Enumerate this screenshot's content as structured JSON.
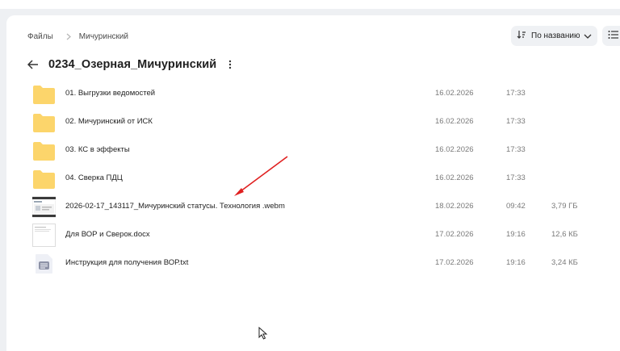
{
  "breadcrumb": {
    "root": "Файлы",
    "current": "Мичуринский"
  },
  "sort": {
    "label": "По названию"
  },
  "folder": {
    "title": "0234_Озерная_Мичуринский"
  },
  "files": [
    {
      "name": "01. Выгрузки ведомостей",
      "date": "16.02.2026",
      "time": "17:33",
      "size": "",
      "type": "folder"
    },
    {
      "name": "02. Мичуринский от ИСК",
      "date": "16.02.2026",
      "time": "17:33",
      "size": "",
      "type": "folder"
    },
    {
      "name": "03. КС в эффекты",
      "date": "16.02.2026",
      "time": "17:33",
      "size": "",
      "type": "folder"
    },
    {
      "name": "04. Сверка ПДЦ",
      "date": "16.02.2026",
      "time": "17:33",
      "size": "",
      "type": "folder"
    },
    {
      "name": "2026-02-17_143117_Мичуринский статусы. Технология .webm",
      "date": "18.02.2026",
      "time": "09:42",
      "size": "3,79 ГБ",
      "type": "video"
    },
    {
      "name": "Для ВОР и Сверок.docx",
      "date": "17.02.2026",
      "time": "19:16",
      "size": "12,6 КБ",
      "type": "doc"
    },
    {
      "name": "Инструкция для получения ВОР.txt",
      "date": "17.02.2026",
      "time": "19:16",
      "size": "3,24 КБ",
      "type": "txt"
    }
  ],
  "colors": {
    "folder": "#fcd56b",
    "accent_arrow": "#e02020",
    "page_bg": "#ffffff",
    "canvas_bg": "#eef0f3"
  },
  "icons": [
    "chevron-right-icon",
    "sort-icon",
    "chevron-down-icon",
    "list-view-icon",
    "back-arrow-icon",
    "more-vertical-icon",
    "folder-icon",
    "video-thumb-icon",
    "doc-thumb-icon",
    "txt-file-icon",
    "mouse-cursor-icon"
  ]
}
